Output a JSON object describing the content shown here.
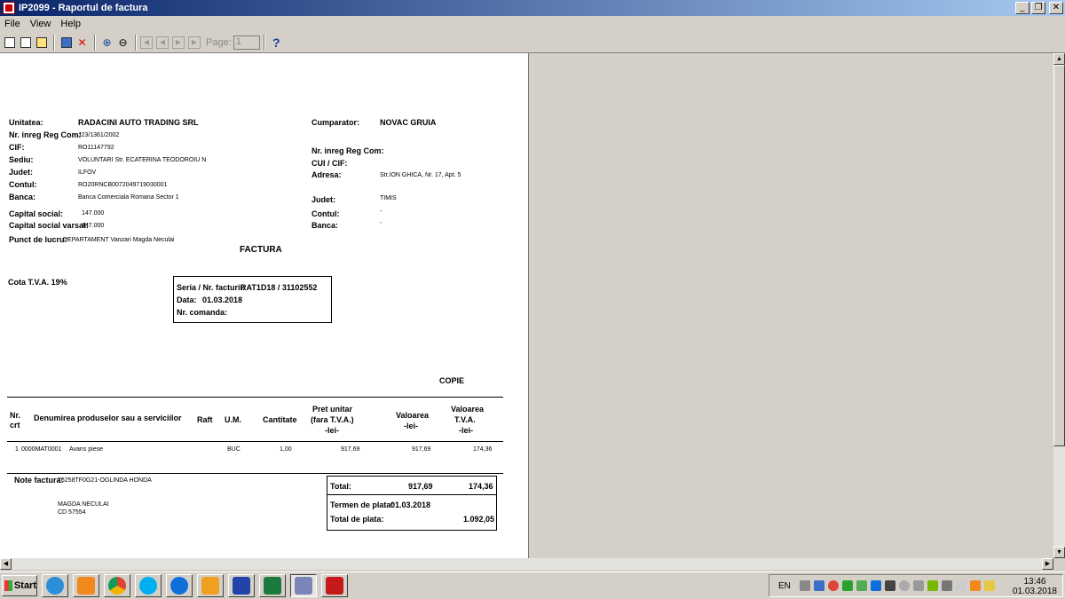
{
  "window": {
    "title": "IP2099 - Raportul de factura",
    "minimize": "_",
    "restore": "❐",
    "close": "✕"
  },
  "menu": {
    "file": "File",
    "view": "View",
    "help": "Help"
  },
  "toolbar": {
    "page_label": "Page:",
    "page_value": "1",
    "help_label": "?"
  },
  "invoice": {
    "seller": {
      "unitatea_label": "Unitatea:",
      "unitatea": "RADACINI AUTO TRADING SRL",
      "reg_com_label": "Nr. inreg Reg Com:",
      "reg_com": "J23/1361/2002",
      "cif_label": "CIF:",
      "cif": "RO11147792",
      "sediu_label": "Sediu:",
      "sediu": "VOLUNTARI Str. ECATERINA TEODOROIU N",
      "judet_label": "Judet:",
      "judet": "ILFOV",
      "contul_label": "Contul:",
      "contul": "RO20RNCB0072049719030001",
      "banca_label": "Banca:",
      "banca": "Banca Comerciala  Romana Sector 1",
      "capital_label": "Capital social:",
      "capital": "147.000",
      "capital_varsat_label": "Capital social varsat:",
      "capital_varsat": "147.000",
      "punct_label": "Punct de lucru:",
      "punct": "DEPARTAMENT  Vanzari Magda Neculai"
    },
    "buyer": {
      "cumparator_label": "Cumparator:",
      "cumparator": "NOVAC GRUIA",
      "reg_com_label": "Nr. inreg Reg Com:",
      "cui_label": "CUI / CIF:",
      "adresa_label": "Adresa:",
      "adresa": "Str.ION GHICA, Nr. 17, Apt. 5",
      "judet_label": "Judet:",
      "judet": "TIMIS",
      "contul_label": "Contul:",
      "contul": "-",
      "banca_label": "Banca:",
      "banca": "-"
    },
    "doc_title": "FACTURA",
    "tva_rate": "Cota T.V.A. 19%",
    "serie_label": "Seria / Nr. facturii:",
    "serie": "RAT1D18 / 31102552",
    "data_label": "Data:",
    "data": "01.03.2018",
    "comanda_label": "Nr. comanda:",
    "copy_mark": "COPIE",
    "columns": {
      "nr_1": "Nr.",
      "nr_2": "crt",
      "denumire": "Denumirea produselor sau a serviciilor",
      "raft": "Raft",
      "um": "U.M.",
      "cantitate": "Cantitate",
      "pret_1": "Pret unitar",
      "pret_2": "(fara T.V.A.)",
      "pret_3": "-lei-",
      "valoare_1": "Valoarea",
      "valoare_2": "-lei-",
      "tva_1": "Valoarea",
      "tva_2": "T.V.A.",
      "tva_3": "-lei-"
    },
    "rows": [
      {
        "nr": "1",
        "cod": "0000MAT0001",
        "denumire": "Avans piese",
        "um": "BUC",
        "cantitate": "1,00",
        "pret": "917,69",
        "valoare": "917,69",
        "tva": "174,36"
      }
    ],
    "note_label": "Note factura:",
    "note": "76258TF0G21-OGLINDA HONDA",
    "delegate_name": "MAGDA NECULAI",
    "delegate_id": "CD 57554",
    "total_label": "Total:",
    "total_valoare": "917,69",
    "total_tva": "174,36",
    "termen_label": "Termen de plata:",
    "termen": "01.03.2018",
    "total_plata_label": "Total de plata:",
    "total_plata": "1.092,05"
  },
  "taskbar": {
    "start": "Start",
    "lang": "EN",
    "time": "13:46",
    "date": "01.03.2018"
  }
}
